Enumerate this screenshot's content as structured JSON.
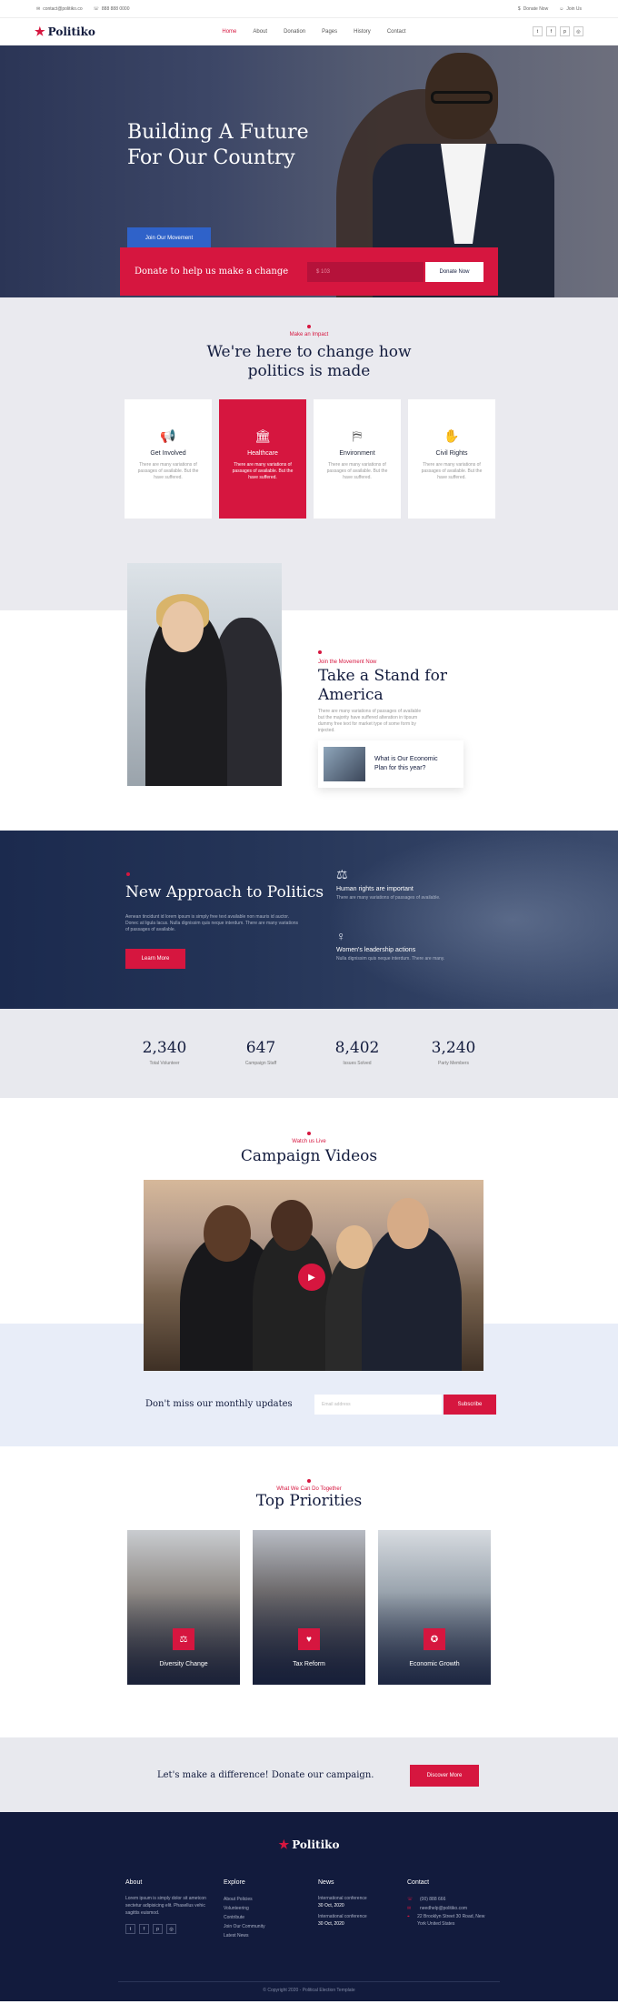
{
  "topbar": {
    "email": "contact@politiko.co",
    "phone": "888 888 0000",
    "donate": "Donate Now",
    "join": "Join Us"
  },
  "nav": {
    "logo": "Politiko",
    "items": [
      "Home",
      "About",
      "Donation",
      "Pages",
      "History",
      "Contact"
    ]
  },
  "hero": {
    "title_line1": "Building A Future",
    "title_line2": "For Our Country",
    "button": "Join Our Movement"
  },
  "donate": {
    "text": "Donate to help us make a change",
    "amount_placeholder": "$ 103",
    "button": "Donate Now"
  },
  "impact": {
    "kicker": "Make an Impact",
    "title_line1": "We're here to change how",
    "title_line2": "politics is made",
    "cards": [
      {
        "title": "Get Involved",
        "desc": "There are many variations of passages of available. But the have suffered.",
        "icon": "megaphone-icon"
      },
      {
        "title": "Healthcare",
        "desc": "There are many variations of passages of available. But the have suffered.",
        "icon": "building-icon"
      },
      {
        "title": "Environment",
        "desc": "There are many variations of passages of available. But the have suffered.",
        "icon": "signpost-icon"
      },
      {
        "title": "Civil Rights",
        "desc": "There are many variations of passages of available. But the have suffered.",
        "icon": "hands-icon"
      }
    ]
  },
  "stand": {
    "kicker": "Join the Movement Now",
    "title_line1": "Take a Stand for",
    "title_line2": "America",
    "text": "There are many variations of passages of available but the majority have suffered alteration in tipsum dummy free text for market type of some form by injected.",
    "econ_line1": "What is Our Economic",
    "econ_line2": "Plan for this year?"
  },
  "approach": {
    "title": "New Approach to Politics",
    "text": "Aenean tincidunt id lorem ipsum is simply free text available non mauris id auctor. Donec at ligula lacus. Nulla dignissim quis neque interdum. There are many variations of passages of available.",
    "button": "Learn More",
    "features": [
      {
        "title": "Human rights are important",
        "desc": "There are many variations of passages of available.",
        "icon": "scales-icon"
      },
      {
        "title": "Women's leadership actions",
        "desc": "Nulla dignissim quis neque interdum. There are many.",
        "icon": "woman-icon"
      }
    ]
  },
  "stats": [
    {
      "value": "2,340",
      "label": "Total Volunteer"
    },
    {
      "value": "647",
      "label": "Campaign Staff"
    },
    {
      "value": "8,402",
      "label": "Issues Solved"
    },
    {
      "value": "3,240",
      "label": "Party Members"
    }
  ],
  "videos": {
    "kicker": "Watch us Live",
    "title": "Campaign Videos"
  },
  "newsletter": {
    "title": "Don't miss our monthly updates",
    "placeholder": "Email address",
    "button": "Subscribe"
  },
  "priorities": {
    "kicker": "What We Can Do Together",
    "title": "Top Priorities",
    "cards": [
      {
        "label": "Diversity Change",
        "icon": "balance-icon"
      },
      {
        "label": "Tax Reform",
        "icon": "hand-heart-icon"
      },
      {
        "label": "Economic Growth",
        "icon": "medal-icon"
      }
    ]
  },
  "cta": {
    "text": "Let's make a difference! Donate our campaign.",
    "button": "Discover More"
  },
  "footer": {
    "logo": "Politiko",
    "about_title": "About",
    "about_text": "Lorem ipsum is simply dolor sit ametcon sectetur adipisicing elit. Phasellus vehic sagittis euismod.",
    "explore_title": "Explore",
    "explore_items": [
      "About Policies",
      "Volunteering",
      "Contribute",
      "Join Our Community",
      "Latest News"
    ],
    "news_title": "News",
    "news": [
      {
        "title": "International conference",
        "date": "30 Oct, 2020"
      },
      {
        "title": "International conference",
        "date": "30 Oct, 2020"
      }
    ],
    "contact_title": "Contact",
    "contact": [
      "(00) 888 666",
      "needhelp@politiko.com",
      "22 Brooklyn Street 30 Road, New York United States"
    ],
    "copyright": "© Copyright 2020 - Political Election Template"
  },
  "colors": {
    "accent": "#d6163f",
    "navy": "#121b3d",
    "blue": "#2f62c9"
  }
}
